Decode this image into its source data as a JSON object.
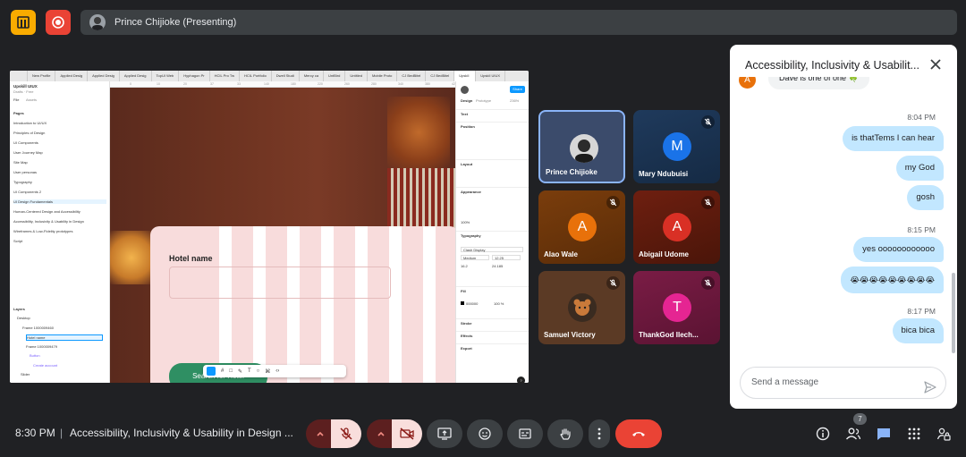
{
  "presenting_banner": "Prince Chijioke (Presenting)",
  "shared_screen": {
    "tabs": [
      "",
      "New Profile",
      "Applied Desig",
      "Applied Desig",
      "Applied Desig",
      "TopUI Web",
      "Hyphagon Pr",
      "HCIL Pro Tw",
      "HCIL Portfolio",
      "Dwell Studi",
      "Mercy ca",
      "UntBird",
      "Untitled",
      "Mobile Proto",
      "CJ BedBitel",
      "CJ BedBitel",
      "UpskIl",
      "UpskIl UIUX"
    ],
    "active_tab_index": 16,
    "ruler_marks": [
      "0",
      "10",
      "20",
      "37",
      "33",
      "140",
      "180",
      "220",
      "260",
      "280",
      "340",
      "380",
      "420"
    ],
    "left_panel": {
      "file_name": "Upskill UIUX",
      "file_sub": "Drafts · Free",
      "tabs": [
        "File",
        "Assets"
      ],
      "pages_header": "Pages",
      "pages": [
        "Introduction to UI/UX",
        "Principles of Design",
        "UI Components",
        "User Journey Map",
        "Site Map",
        "User personas",
        "Typography",
        "UI Components 2",
        "UI Design Fundamentals",
        "Human-Centered Design and Accessibility",
        "Accessibility, Inclusivity & Usability in Design",
        "Wireframes & Low-Fidelity prototypes",
        "Script"
      ],
      "active_page_index": 8,
      "layers_header": "Layers",
      "layers": [
        "Desktop",
        "Frame 1000009460",
        "Hotel name",
        "Frame 1000009479",
        "Button",
        "Create account",
        "Slider",
        "Nav Bar"
      ]
    },
    "canvas": {
      "field_label": "Hotel name",
      "button_label": "Search for Hotel"
    },
    "right_panel": {
      "tabs": [
        "Design",
        "Prototype"
      ],
      "zoom": "236%",
      "share_label": "Share",
      "sections": [
        "Text",
        "Position",
        "Layout",
        "Appearance",
        "Typography",
        "Fill",
        "Stroke",
        "Effects",
        "Export"
      ],
      "font_name": "Clash Display",
      "font_weight": "Medium",
      "font_size": "12.25",
      "line_height": "16.2",
      "letter_spacing": "24.185",
      "opacity": "100%",
      "fill_hex": "000000",
      "fill_opacity": "100 %"
    }
  },
  "participants": [
    {
      "name": "Prince Chijioke",
      "initial": "",
      "color": "#3b4b6b",
      "muted": false,
      "active": true
    },
    {
      "name": "Mary Ndubuisi",
      "initial": "M",
      "color": "#1a5fb4",
      "muted": true,
      "active": false
    },
    {
      "name": "Alao Wale",
      "initial": "A",
      "color": "#e8710a",
      "muted": true,
      "active": false
    },
    {
      "name": "Abigail Udome",
      "initial": "A",
      "color": "#d93025",
      "muted": true,
      "active": false
    },
    {
      "name": "Samuel Victory",
      "initial": "",
      "color": "#5b3a25",
      "muted": true,
      "active": false
    },
    {
      "name": "ThankGod Ilech...",
      "initial": "T",
      "color": "#e52592",
      "muted": true,
      "active": false
    }
  ],
  "chat": {
    "title": "Accessibility, Inclusivity & Usabilit...",
    "incoming": {
      "initial": "A",
      "text": "Dave is one of one 🍀"
    },
    "groups": [
      {
        "time": "8:04 PM",
        "messages": [
          "is thatTems I can hear",
          "my God",
          "gosh"
        ]
      },
      {
        "time": "8:15 PM",
        "messages": [
          "yes oooooooooooo",
          "😭😭😭😭😭😭😭😭😭"
        ]
      },
      {
        "time": "8:17 PM",
        "messages": [
          "bica bica"
        ]
      }
    ],
    "input_placeholder": "Send a message"
  },
  "bottom_bar": {
    "time": "8:30 PM",
    "separator": "|",
    "meeting_title": "Accessibility, Inclusivity & Usability in Design ...",
    "people_count": "7"
  },
  "colors": {
    "background": "#202124",
    "end_call": "#ea4335",
    "chat_bubble": "#c2e7ff",
    "active_tile_border": "#8ab4f8"
  }
}
